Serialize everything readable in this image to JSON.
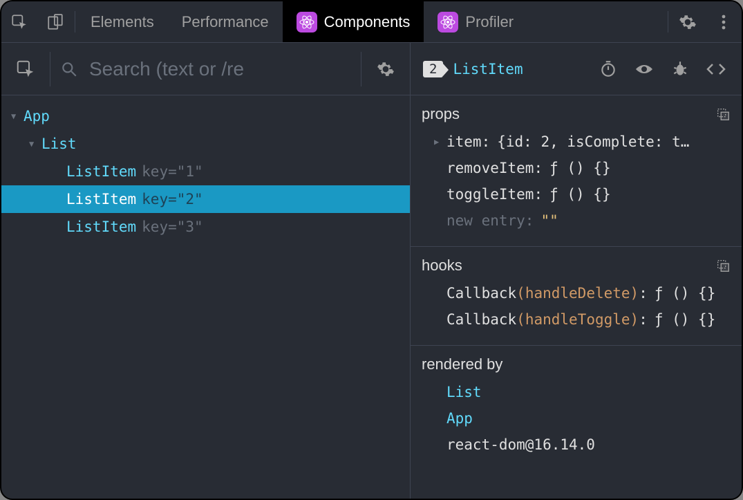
{
  "tabs": {
    "elements": "Elements",
    "performance": "Performance",
    "components": "Components",
    "profiler": "Profiler"
  },
  "search": {
    "placeholder": "Search (text or /re"
  },
  "tree": {
    "root": "App",
    "child": "List",
    "items": [
      {
        "name": "ListItem",
        "key_label": "key=",
        "key_value": "\"1\"",
        "selected": false
      },
      {
        "name": "ListItem",
        "key_label": "key=",
        "key_value": "\"2\"",
        "selected": true
      },
      {
        "name": "ListItem",
        "key_label": "key=",
        "key_value": "\"3\"",
        "selected": false
      }
    ]
  },
  "detail": {
    "badge": "2",
    "title": "ListItem"
  },
  "props": {
    "title": "props",
    "item_key": "item",
    "item_val": "{id: 2, isComplete: t…",
    "remove_key": "removeItem",
    "remove_val": "ƒ () {}",
    "toggle_key": "toggleItem",
    "toggle_val": "ƒ () {}",
    "new_entry_key": "new entry",
    "new_entry_val": "\"\""
  },
  "hooks": {
    "title": "hooks",
    "rows": [
      {
        "prefix": "Callback",
        "name": "handleDelete",
        "val": "ƒ () {}"
      },
      {
        "prefix": "Callback",
        "name": "handleToggle",
        "val": "ƒ () {}"
      }
    ]
  },
  "rendered": {
    "title": "rendered by",
    "links": [
      "List",
      "App"
    ],
    "footer": "react-dom@16.14.0"
  }
}
